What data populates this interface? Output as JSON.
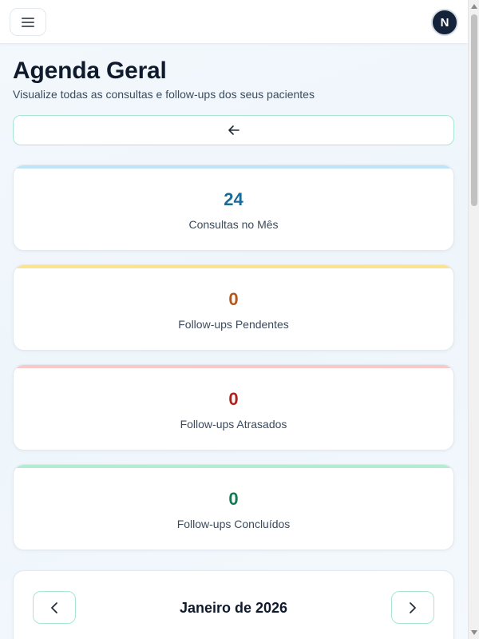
{
  "header": {
    "menu_icon": "hamburger-menu-icon",
    "avatar_initial": "N"
  },
  "page": {
    "title": "Agenda Geral",
    "subtitle": "Visualize todas as consultas e follow-ups dos seus pacientes",
    "back_icon": "arrow-left-icon"
  },
  "stats": [
    {
      "value": "24",
      "label": "Consultas no Mês",
      "accent": "#bfe3f7",
      "value_color": "#1a6b96"
    },
    {
      "value": "0",
      "label": "Follow-ups Pendentes",
      "accent": "#fbe38f",
      "value_color": "#b4571a"
    },
    {
      "value": "0",
      "label": "Follow-ups Atrasados",
      "accent": "#f8c9c9",
      "value_color": "#b01e1e"
    },
    {
      "value": "0",
      "label": "Follow-ups Concluídos",
      "accent": "#b3ecd2",
      "value_color": "#107a52"
    }
  ],
  "calendar": {
    "month_label": "Janeiro de 2026",
    "prev_icon": "chevron-left-icon",
    "next_icon": "chevron-right-icon"
  },
  "colors": {
    "primary_dark": "#0f1b2d",
    "outline_mint": "#a9e6d3"
  }
}
